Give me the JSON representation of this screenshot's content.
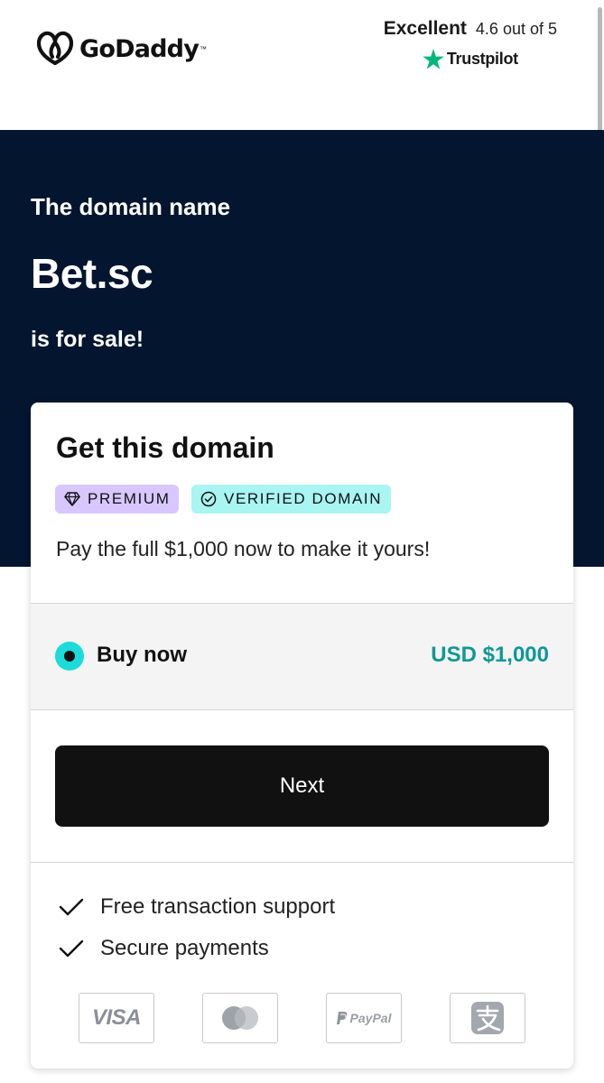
{
  "header": {
    "brand": "GoDaddy",
    "brand_tm": "™",
    "rating_word": "Excellent",
    "rating_score": "4.6 out of 5",
    "trustpilot": "Trustpilot"
  },
  "hero": {
    "pre_text": "The domain name",
    "domain": "Bet.sc",
    "post_text": "is for sale!",
    "background_color": "#03152f"
  },
  "card": {
    "title": "Get this domain",
    "badges": [
      {
        "label": "PREMIUM",
        "icon": "diamond-icon",
        "color": "#d8c7ff"
      },
      {
        "label": "VERIFIED DOMAIN",
        "icon": "check-circle-icon",
        "color": "#a8f5f2"
      }
    ],
    "pay_text": "Pay the full $1,000 now to make it yours!",
    "option": {
      "label": "Buy now",
      "price": "USD $1,000",
      "selected": true,
      "price_color": "#0f9897",
      "radio_color": "#1bdbdb"
    },
    "next_label": "Next",
    "features": [
      {
        "icon": "check-icon",
        "label": "Free transaction support"
      },
      {
        "icon": "check-icon",
        "label": "Secure payments"
      }
    ],
    "payment_methods": {
      "visa": "VISA",
      "mastercard": "mastercard-icon",
      "paypal": "PayPal",
      "alipay": "alipay-icon"
    }
  },
  "colors": {
    "trustpilot_green": "#00b67a",
    "button": "#111111"
  }
}
